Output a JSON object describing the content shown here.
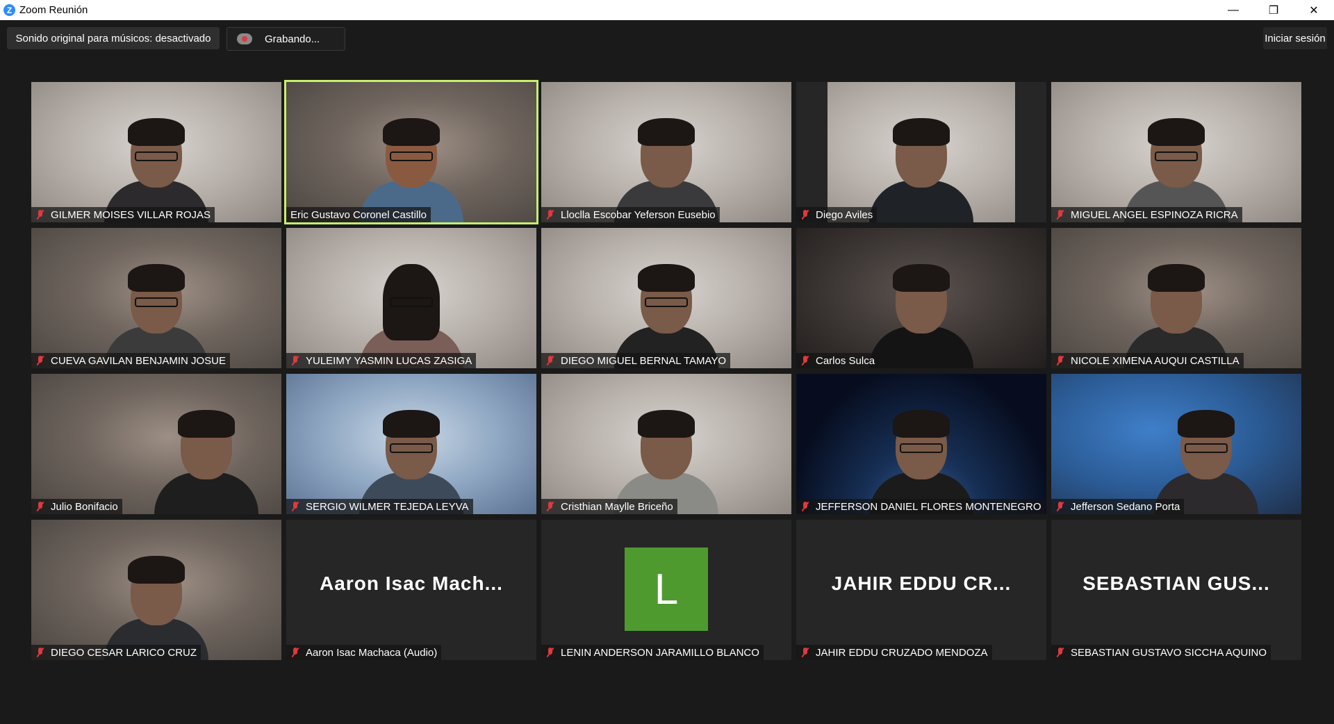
{
  "window": {
    "title": "Zoom Reunión",
    "app_icon": "Z",
    "controls": {
      "minimize": "—",
      "maximize": "❐",
      "close": "✕"
    }
  },
  "toolbar": {
    "original_sound": "Sonido original para músicos: desactivado",
    "recording": "Grabando...",
    "sign_in": "Iniciar sesión"
  },
  "colors": {
    "active_speaker": "#c6f06a",
    "mic_muted": "#e0393e",
    "avatar_bg": "#4e9a2f",
    "background": "#1a1a1a"
  },
  "participants": [
    {
      "name": "GILMER MOISES VILLAR ROJAS",
      "muted": true
    },
    {
      "name": "Eric Gustavo Coronel Castillo",
      "muted": false,
      "active_speaker": true
    },
    {
      "name": "Lloclla Escobar Yeferson Eusebio",
      "muted": true
    },
    {
      "name": "Diego Aviles",
      "muted": true
    },
    {
      "name": "MIGUEL ANGEL ESPINOZA RICRA",
      "muted": true
    },
    {
      "name": "CUEVA GAVILAN BENJAMIN JOSUE",
      "muted": true
    },
    {
      "name": "YULEIMY YASMIN LUCAS ZASIGA",
      "muted": true
    },
    {
      "name": "DIEGO MIGUEL BERNAL TAMAYO",
      "muted": true
    },
    {
      "name": "Carlos Sulca",
      "muted": true
    },
    {
      "name": "NICOLE XIMENA AUQUI CASTILLA",
      "muted": true
    },
    {
      "name": "Julio Bonifacio",
      "muted": true
    },
    {
      "name": "SERGIO WILMER TEJEDA LEYVA",
      "muted": true
    },
    {
      "name": "Cristhian Maylle Briceño",
      "muted": true
    },
    {
      "name": "JEFFERSON DANIEL FLORES MONTENEGRO",
      "muted": true
    },
    {
      "name": "Jefferson Sedano Porta",
      "muted": true
    },
    {
      "name": "DIEGO CESAR LARICO CRUZ",
      "muted": true
    },
    {
      "name": "Aaron Isac Machaca (Audio)",
      "muted": true,
      "display": "Aaron  Isac  Mach..."
    },
    {
      "name": "LENIN ANDERSON JARAMILLO BLANCO",
      "muted": true,
      "avatar_letter": "L"
    },
    {
      "name": "JAHIR EDDU CRUZADO MENDOZA",
      "muted": true,
      "display": "JAHIR  EDDU  CR..."
    },
    {
      "name": "SEBASTIAN GUSTAVO SICCHA AQUINO",
      "muted": true,
      "display": "SEBASTIAN  GUS..."
    }
  ]
}
